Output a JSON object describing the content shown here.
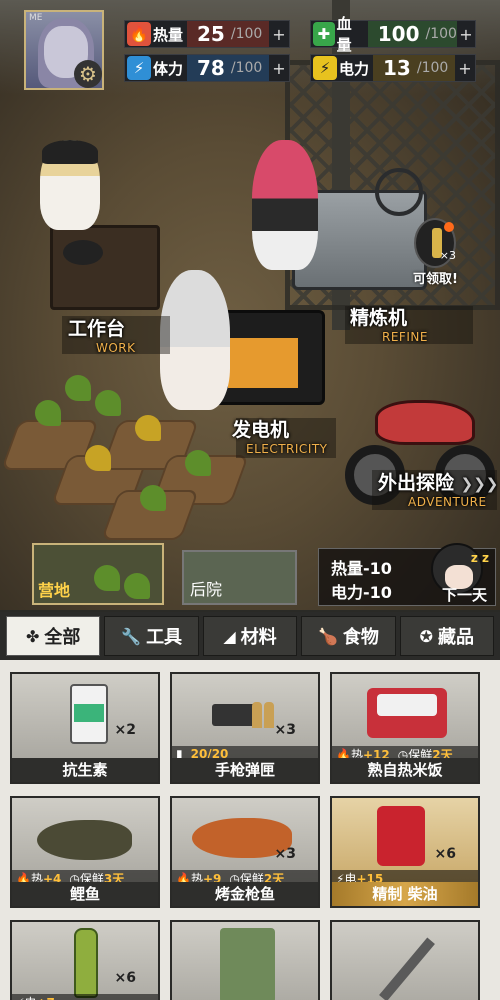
{
  "profile": {
    "level_tag": "ME"
  },
  "stats": {
    "calories": {
      "label": "热量",
      "value": "25",
      "max": "/100",
      "plus": "+",
      "color": "#e0533c"
    },
    "stamina": {
      "label": "体力",
      "value": "78",
      "max": "/100",
      "plus": "+",
      "color": "#2f8fd6"
    },
    "health": {
      "label": "血量",
      "value": "100",
      "max": "/100",
      "plus": "+",
      "color": "#38a64a"
    },
    "power": {
      "label": "电力",
      "value": "13",
      "max": "/100",
      "plus": "+",
      "color": "#e7c21f"
    }
  },
  "locations": {
    "workbench": {
      "cn": "工作台",
      "en": "WORK"
    },
    "refinery": {
      "cn": "精炼机",
      "en": "REFINE"
    },
    "generator": {
      "cn": "发电机",
      "en": "ELECTRICITY"
    },
    "adventure": {
      "cn": "外出探险",
      "arrows": "❯❯❯",
      "en": "ADVENTURE"
    }
  },
  "claim": {
    "count": "×3",
    "label": "可领取!"
  },
  "scenes": {
    "camp": "营地",
    "backyard": "后院"
  },
  "next_day": {
    "cost_calories": "热量-10",
    "cost_power": "电力-10",
    "label": "下一天",
    "z": "z z"
  },
  "tabs": [
    {
      "icon": "✤",
      "label": "全部"
    },
    {
      "icon": "🔧",
      "label": "工具"
    },
    {
      "icon": "◢",
      "label": "材料"
    },
    {
      "icon": "🍗",
      "label": "食物"
    },
    {
      "icon": "✪",
      "label": "藏品"
    }
  ],
  "items": [
    {
      "name": "抗生素",
      "count": "×2"
    },
    {
      "name": "手枪弹匣",
      "count": "×3",
      "ammo": "20/20"
    },
    {
      "name": "熟自热米饭",
      "count": "",
      "heat_label": "热",
      "heat": "+12",
      "fresh_label": "保鲜",
      "fresh": "2天"
    },
    {
      "name": "鲤鱼",
      "count": "",
      "heat_label": "热",
      "heat": "+4",
      "fresh_label": "保鲜",
      "fresh": "3天"
    },
    {
      "name": "烤金枪鱼",
      "count": "×3",
      "heat_label": "热",
      "heat": "+9",
      "fresh_label": "保鲜",
      "fresh": "2天"
    },
    {
      "name": "精制 柴油",
      "count": "×6",
      "power_label": "电",
      "power": "+15"
    },
    {
      "name": "",
      "count": "×6",
      "power_label": "电",
      "power": "+7"
    },
    {
      "name": "",
      "count": ""
    },
    {
      "name": "",
      "count": ""
    }
  ]
}
